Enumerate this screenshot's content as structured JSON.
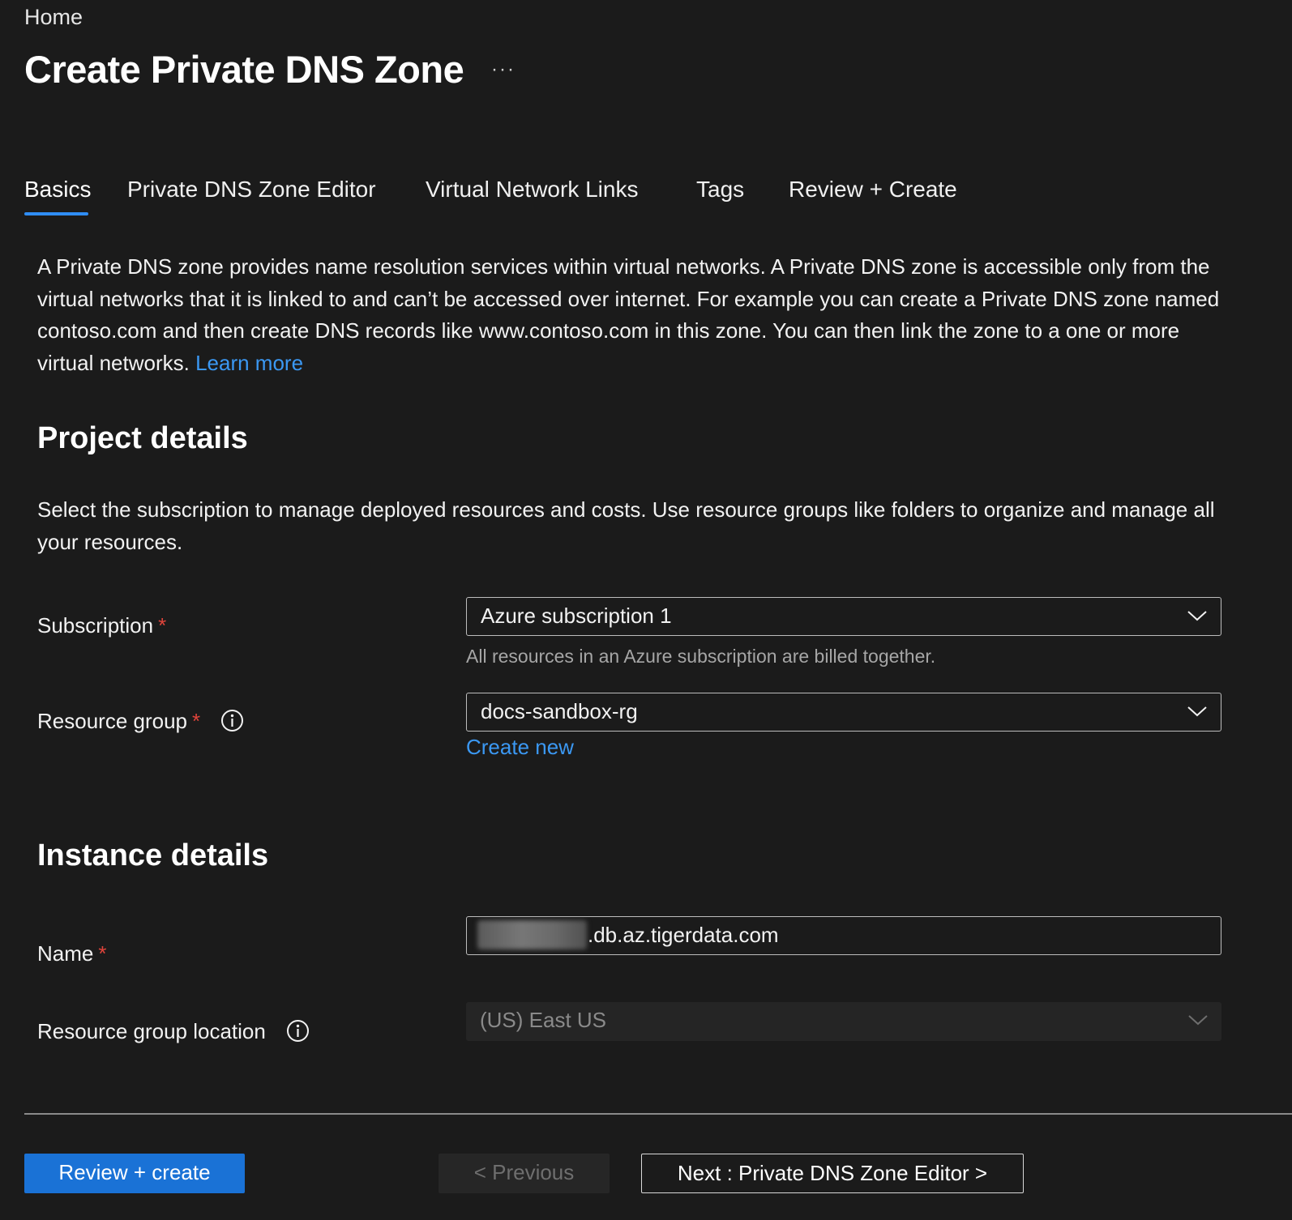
{
  "breadcrumb": "Home",
  "title": "Create Private DNS Zone",
  "more_label": "···",
  "tabs": [
    {
      "label": "Basics",
      "active": true
    },
    {
      "label": "Private DNS Zone Editor",
      "active": false
    },
    {
      "label": "Virtual Network Links",
      "active": false
    },
    {
      "label": "Tags",
      "active": false
    },
    {
      "label": "Review + Create",
      "active": false
    }
  ],
  "intro": {
    "text": "A Private DNS zone provides name resolution services within virtual networks. A Private DNS zone is accessible only from the virtual networks that it is linked to and can’t be accessed over internet. For example you can create a Private DNS zone named contoso.com and then create DNS records like www.contoso.com in this zone. You can then link the zone to a one or more virtual networks.",
    "learn_more": "Learn more"
  },
  "project": {
    "title": "Project details",
    "description": "Select the subscription to manage deployed resources and costs. Use resource groups like folders to organize and manage all your resources.",
    "subscription_label": "Subscription",
    "subscription_value": "Azure subscription 1",
    "subscription_help": "All resources in an Azure subscription are billed together.",
    "resource_group_label": "Resource group",
    "resource_group_value": "docs-sandbox-rg",
    "create_new": "Create new",
    "required_marker": "*"
  },
  "instance": {
    "title": "Instance details",
    "name_label": "Name",
    "name_suffix": ".db.az.tigerdata.com",
    "location_label": "Resource group location",
    "location_value": "(US) East US"
  },
  "footer": {
    "review_create": "Review + create",
    "previous": "< Previous",
    "next": "Next : Private DNS Zone Editor >"
  },
  "colors": {
    "background": "#1b1b1b",
    "accent": "#1a72d6",
    "link": "#3b98f3",
    "required": "#e0443b"
  }
}
